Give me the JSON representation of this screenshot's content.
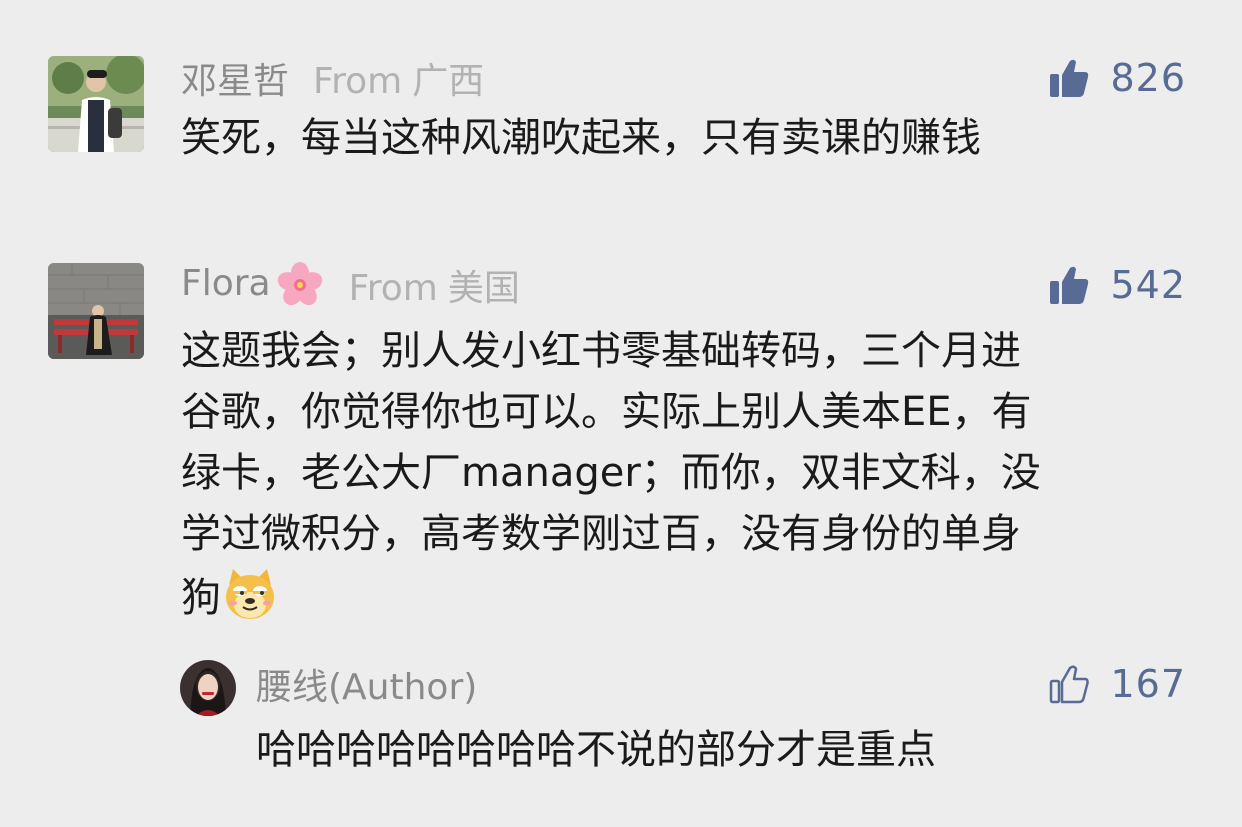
{
  "comments": [
    {
      "user": "邓星哲",
      "from_label": "From",
      "location": "广西",
      "likes": "826",
      "text": "笑死，每当这种风潮吹起来，只有卖课的赚钱"
    },
    {
      "user": "Flora",
      "user_emoji": "cherry-blossom-icon",
      "from_label": "From",
      "location": "美国",
      "likes": "542",
      "lines": [
        "这题我会；别人发小红书零基础转码，三个月进",
        "谷歌，你觉得你也可以。实际上别人美本EE，有",
        "绿卡，老公大厂manager；而你，双非文科，没",
        "学过微积分，高考数学刚过百，没有身份的单身",
        "狗"
      ],
      "trailing_emoji": "doge-icon"
    }
  ],
  "reply": {
    "user": "腰线(Author)",
    "likes": "167",
    "text": "哈哈哈哈哈哈哈哈不说的部分才是重点"
  },
  "colors": {
    "background": "#ededed",
    "name": "#8a8a8a",
    "location": "#b2b2b2",
    "like_accent": "#576b95",
    "text": "#1a1a1a"
  },
  "icons": [
    "thumbs-up-filled-icon",
    "thumbs-up-outline-icon"
  ]
}
